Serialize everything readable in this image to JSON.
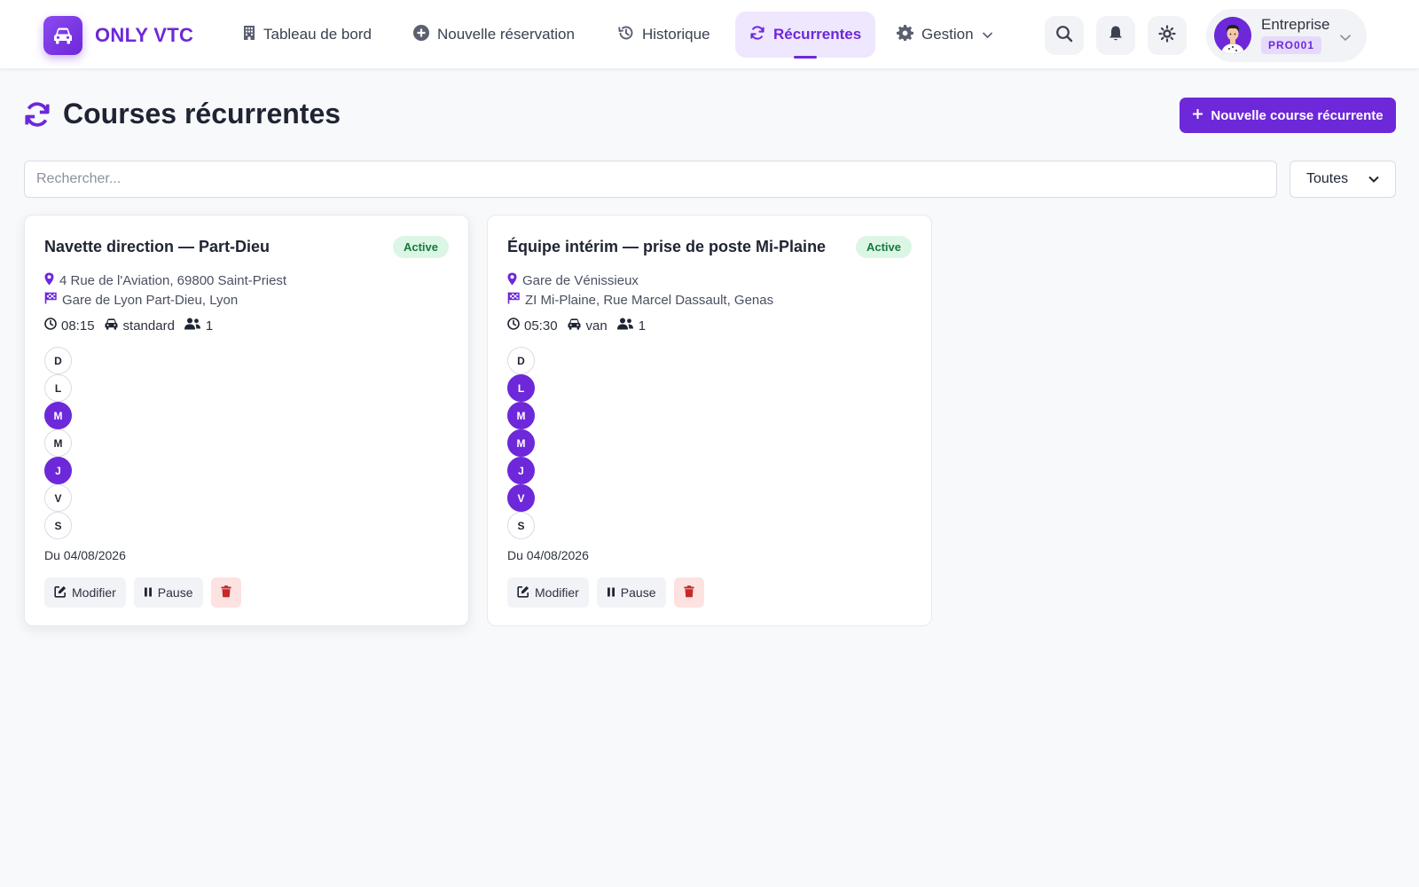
{
  "app": {
    "name": "ONLY VTC"
  },
  "nav": {
    "items": [
      {
        "label": "Tableau de bord",
        "icon": "building-icon"
      },
      {
        "label": "Nouvelle réservation",
        "icon": "plus-circle-icon"
      },
      {
        "label": "Historique",
        "icon": "history-icon"
      },
      {
        "label": "Récurrentes",
        "icon": "sync-icon",
        "active": true
      },
      {
        "label": "Gestion",
        "icon": "gear-icon"
      }
    ]
  },
  "user": {
    "name": "Entreprise",
    "code": "PRO001"
  },
  "page": {
    "title": "Courses récurrentes",
    "new_button": "Nouvelle course récurrente",
    "search_placeholder": "Rechercher...",
    "filter_value": "Toutes"
  },
  "cards": [
    {
      "title": "Navette direction — Part-Dieu",
      "status": "Active",
      "pickup": "4 Rue de l'Aviation, 69800 Saint-Priest",
      "dropoff": "Gare de Lyon Part-Dieu, Lyon",
      "time": "08:15",
      "vehicle": "standard",
      "passengers": "1",
      "days": [
        {
          "letter": "D",
          "on": false
        },
        {
          "letter": "L",
          "on": false
        },
        {
          "letter": "M",
          "on": true
        },
        {
          "letter": "M",
          "on": false
        },
        {
          "letter": "J",
          "on": true
        },
        {
          "letter": "V",
          "on": false
        },
        {
          "letter": "S",
          "on": false
        }
      ],
      "start_date": "Du 04/08/2026",
      "edit_label": "Modifier",
      "pause_label": "Pause"
    },
    {
      "title": "Équipe intérim — prise de poste Mi-Plaine",
      "status": "Active",
      "pickup": "Gare de Vénissieux",
      "dropoff": "ZI Mi-Plaine, Rue Marcel Dassault, Genas",
      "time": "05:30",
      "vehicle": "van",
      "passengers": "1",
      "days": [
        {
          "letter": "D",
          "on": false
        },
        {
          "letter": "L",
          "on": true
        },
        {
          "letter": "M",
          "on": true
        },
        {
          "letter": "M",
          "on": true
        },
        {
          "letter": "J",
          "on": true
        },
        {
          "letter": "V",
          "on": true
        },
        {
          "letter": "S",
          "on": false
        }
      ],
      "start_date": "Du 04/08/2026",
      "edit_label": "Modifier",
      "pause_label": "Pause"
    }
  ],
  "colors": {
    "brand": "#6d28d9",
    "active_badge_bg": "#dcf6e5",
    "active_badge_text": "#167a3e",
    "danger_bg": "#fde2e2",
    "danger_icon": "#c62828"
  }
}
